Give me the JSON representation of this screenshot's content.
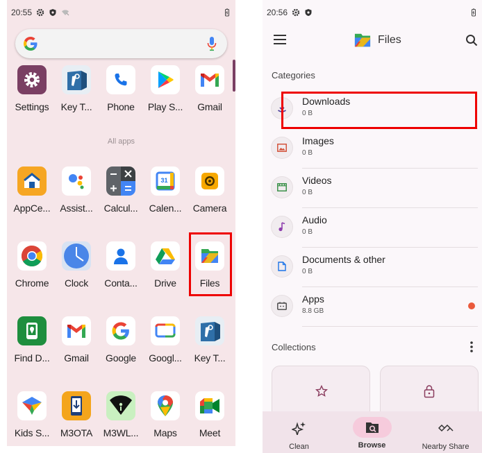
{
  "left": {
    "status": {
      "time": "20:55"
    },
    "search": {
      "logo_letter": "G"
    },
    "all_apps_label": "All apps",
    "apps": [
      {
        "label": "Settings",
        "icon": "settings-icon"
      },
      {
        "label": "Key T...",
        "icon": "key-tool-icon"
      },
      {
        "label": "Phone",
        "icon": "phone-icon"
      },
      {
        "label": "Play S...",
        "icon": "play-store-icon"
      },
      {
        "label": "Gmail",
        "icon": "gmail-icon"
      },
      {
        "label": "AppCe...",
        "icon": "appcenter-icon"
      },
      {
        "label": "Assist...",
        "icon": "assistant-icon"
      },
      {
        "label": "Calcul...",
        "icon": "calculator-icon"
      },
      {
        "label": "Calen...",
        "icon": "calendar-icon"
      },
      {
        "label": "Camera",
        "icon": "camera-icon"
      },
      {
        "label": "Chrome",
        "icon": "chrome-icon"
      },
      {
        "label": "Clock",
        "icon": "clock-icon"
      },
      {
        "label": "Conta...",
        "icon": "contacts-icon"
      },
      {
        "label": "Drive",
        "icon": "drive-icon"
      },
      {
        "label": "Files",
        "icon": "files-icon"
      },
      {
        "label": "Find D...",
        "icon": "find-device-icon"
      },
      {
        "label": "Gmail",
        "icon": "gmail-icon"
      },
      {
        "label": "Google",
        "icon": "google-icon"
      },
      {
        "label": "Googl...",
        "icon": "google-tv-icon"
      },
      {
        "label": "Key T...",
        "icon": "key-tool-icon"
      },
      {
        "label": "Kids S...",
        "icon": "kids-space-icon"
      },
      {
        "label": "M3OTA",
        "icon": "m3ota-icon"
      },
      {
        "label": "M3WL...",
        "icon": "m3wl-icon"
      },
      {
        "label": "Maps",
        "icon": "maps-icon"
      },
      {
        "label": "Meet",
        "icon": "meet-icon"
      }
    ],
    "calendar_day": "31"
  },
  "right": {
    "status": {
      "time": "20:56"
    },
    "title": "Files",
    "categories_label": "Categories",
    "categories": [
      {
        "name": "Downloads",
        "size": "0 B",
        "icon": "download-icon"
      },
      {
        "name": "Images",
        "size": "0 B",
        "icon": "image-icon"
      },
      {
        "name": "Videos",
        "size": "0 B",
        "icon": "video-icon"
      },
      {
        "name": "Audio",
        "size": "0 B",
        "icon": "audio-icon"
      },
      {
        "name": "Documents & other",
        "size": "0 B",
        "icon": "document-icon"
      },
      {
        "name": "Apps",
        "size": "8.8 GB",
        "icon": "apps-icon"
      }
    ],
    "collections_label": "Collections",
    "nav": [
      {
        "label": "Clean",
        "icon": "sparkle-icon"
      },
      {
        "label": "Browse",
        "icon": "browse-icon",
        "active": true
      },
      {
        "label": "Nearby Share",
        "icon": "nearby-share-icon"
      }
    ]
  },
  "colors": {
    "highlight": "#ee0000",
    "left_background": "#f6e6e9",
    "accent_pill": "#f6cbdc"
  }
}
